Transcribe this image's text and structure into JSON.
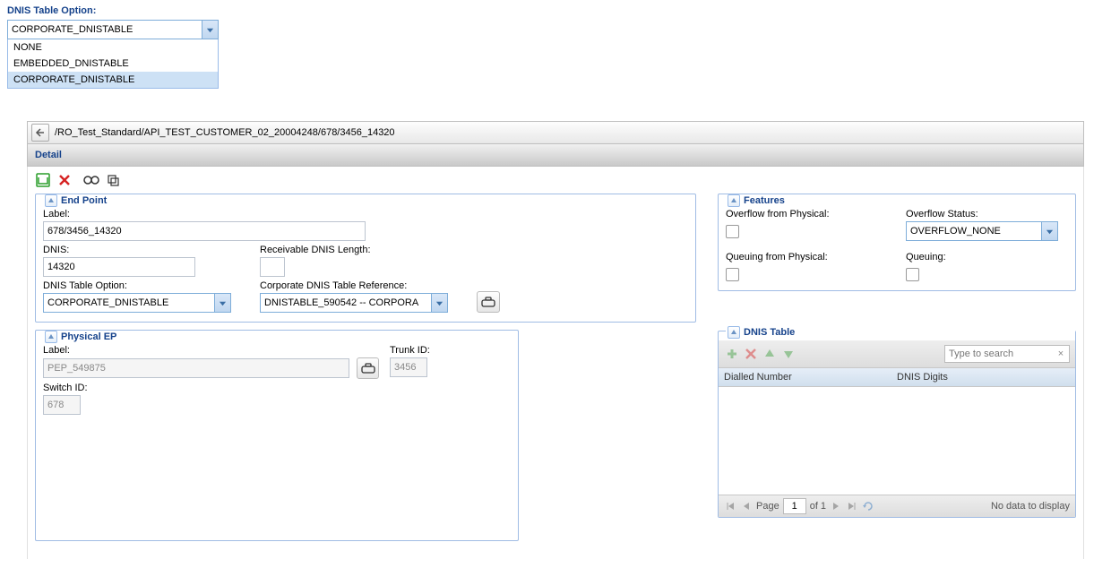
{
  "top_dropdown": {
    "label": "DNIS Table Option:",
    "value": "CORPORATE_DNISTABLE",
    "options": [
      "NONE",
      "EMBEDDED_DNISTABLE",
      "CORPORATE_DNISTABLE"
    ],
    "highlighted_index": 2
  },
  "breadcrumb": "/RO_Test_Standard/API_TEST_CUSTOMER_02_20004248/678/3456_14320",
  "detail_header": "Detail",
  "endpoint": {
    "legend": "End Point",
    "label_label": "Label:",
    "label_value": "678/3456_14320",
    "dnis_label": "DNIS:",
    "dnis_value": "14320",
    "recv_len_label": "Receivable DNIS Length:",
    "recv_len_value": "",
    "dnis_opt_label": "DNIS Table Option:",
    "dnis_opt_value": "CORPORATE_DNISTABLE",
    "corp_ref_label": "Corporate DNIS Table Reference:",
    "corp_ref_value": "DNISTABLE_590542 -- CORPORA"
  },
  "physical_ep": {
    "legend": "Physical EP",
    "label_label": "Label:",
    "label_value": "PEP_549875",
    "switch_label": "Switch ID:",
    "switch_value": "678",
    "trunk_label": "Trunk ID:",
    "trunk_value": "3456"
  },
  "features": {
    "legend": "Features",
    "overflow_phys_label": "Overflow from Physical:",
    "overflow_status_label": "Overflow Status:",
    "overflow_status_value": "OVERFLOW_NONE",
    "queuing_phys_label": "Queuing from Physical:",
    "queuing_label": "Queuing:"
  },
  "dnis_table": {
    "legend": "DNIS Table",
    "search_placeholder": "Type to search",
    "col1": "Dialled Number",
    "col2": "DNIS Digits",
    "page_label_prefix": "Page",
    "page_value": "1",
    "page_label_suffix": "of 1",
    "no_data": "No data to display"
  }
}
